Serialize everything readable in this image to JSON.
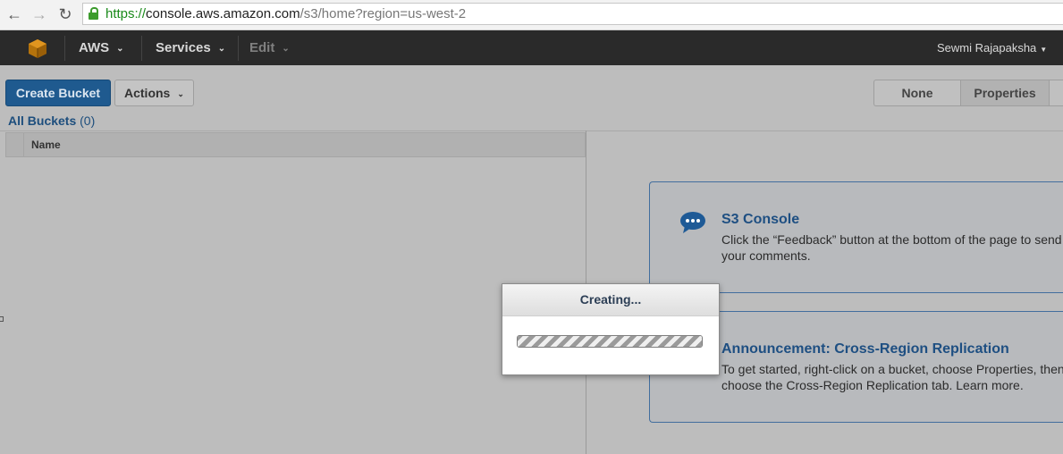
{
  "browser": {
    "url_protocol": "https://",
    "url_host": "console.aws.amazon.com",
    "url_path": "/s3/home?region=us-west-2"
  },
  "nav": {
    "aws_label": "AWS",
    "services_label": "Services",
    "edit_label": "Edit",
    "user_label": "Sewmi Rajapaksha"
  },
  "toolbar": {
    "create_bucket": "Create Bucket",
    "actions": "Actions",
    "view_none": "None",
    "view_properties": "Properties"
  },
  "buckets": {
    "title": "All Buckets",
    "count": "(0)",
    "column_name": "Name"
  },
  "panels": [
    {
      "title": "S3 Console",
      "text": "Click the “Feedback” button at the bottom of the page to send us your comments."
    },
    {
      "title": "Announcement: Cross-Region Replication",
      "text": "To get started, right-click on a bucket, choose Properties, then choose the Cross-Region Replication tab. Learn more."
    }
  ],
  "modal": {
    "title": "Creating...",
    "progress": 1.0
  },
  "colors": {
    "primary_button": "#1f5a8f",
    "link_blue": "#1e4f82",
    "nav_bg": "#2a2a2a"
  }
}
